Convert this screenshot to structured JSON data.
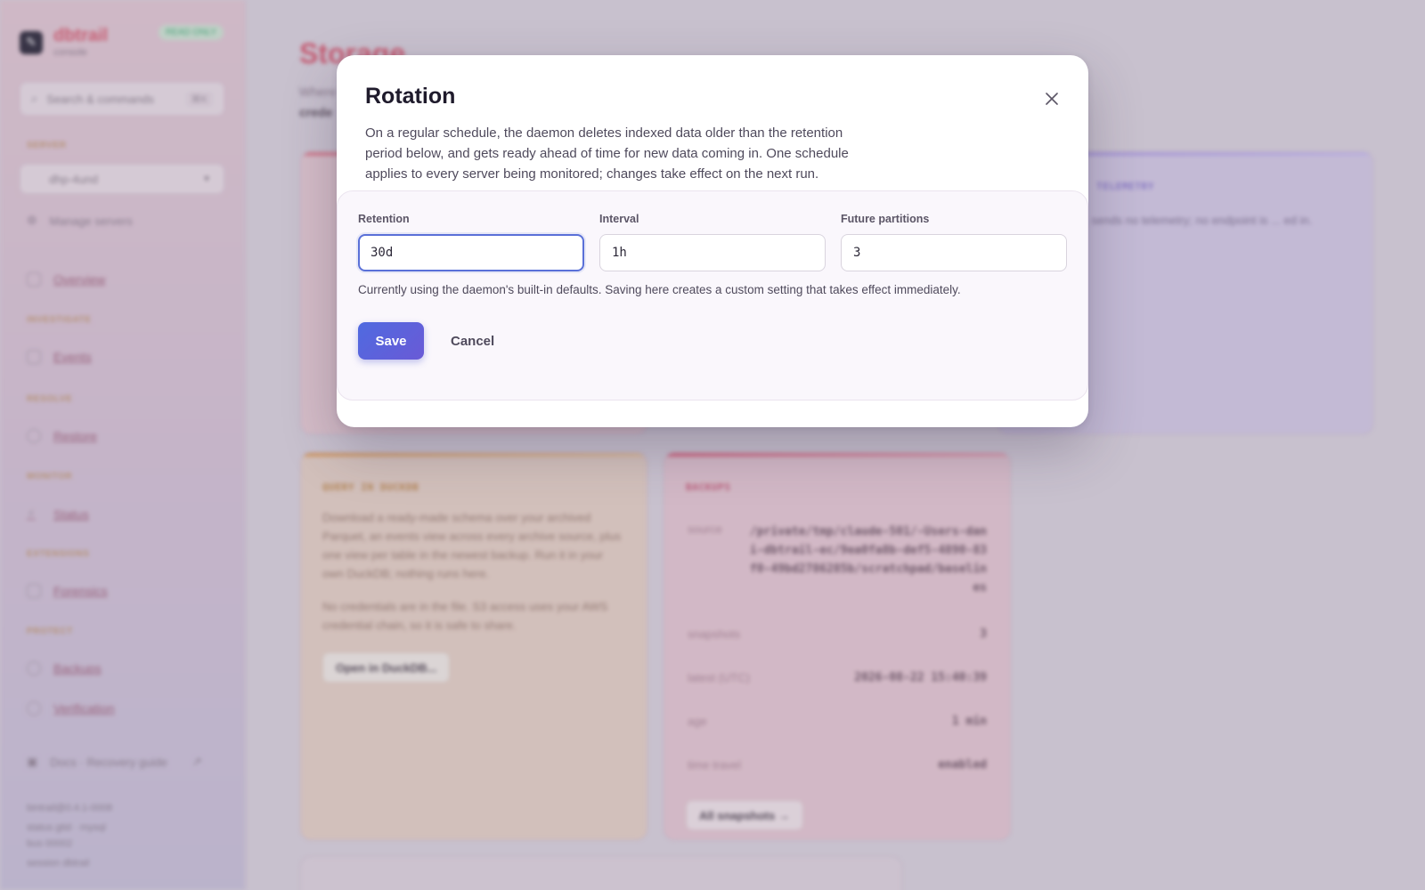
{
  "sidebar": {
    "brand_name": "dbtrail",
    "brand_sub": "console",
    "badge": "READ ONLY",
    "search_placeholder": "Search & commands",
    "search_kbd": "⌘K",
    "servers_section": "SERVER",
    "server_selected": "dhp-4und",
    "manage_servers": "Manage servers",
    "sections": [
      {
        "title": "",
        "items": [
          {
            "label": "Overview"
          }
        ]
      },
      {
        "title": "INVESTIGATE",
        "items": [
          {
            "label": "Events"
          }
        ]
      },
      {
        "title": "RESOLVE",
        "items": [
          {
            "label": "Restore"
          }
        ]
      },
      {
        "title": "MONITOR",
        "items": [
          {
            "label": "Status"
          }
        ]
      },
      {
        "title": "EXTENSIONS",
        "items": [
          {
            "label": "Forensics"
          }
        ]
      },
      {
        "title": "PROTECT",
        "items": [
          {
            "label": "Backups"
          },
          {
            "label": "Verification"
          }
        ]
      }
    ],
    "docs_link": "Docs · Recovery guide",
    "version": "bintrail@0.4.1-0008",
    "footer_1": "status gtid · mysql",
    "footer_2": "bus 00002",
    "footer_3": "session dbtrail"
  },
  "main": {
    "title": "Storage",
    "desc": "Where",
    "desc2": "crede",
    "telemetry_title": "TELEMETRY",
    "telemetry_body": "... sends no telemetry; no endpoint is ... ed in.",
    "query_title": "QUERY IN DUCKDB",
    "query_body_1": "Download a ready-made schema over your archived Parquet, an events view across every archive source, plus one view per table in the newest backup. Run it in your own DuckDB; nothing runs here.",
    "query_body_2": "No credentials are in the file. S3 access uses your AWS credential chain, so it is safe to share.",
    "query_button": "Open in DuckDB...",
    "backups_title": "BACKUPS",
    "backups": {
      "source_label": "source",
      "source_value": "/private/tmp/claude-501/-Users-dani-dbtrail-ec/9ea0fa8b-def5-4890-83f0-49bd2786285b/scratchpad/baselines",
      "snapshots_label": "snapshots",
      "snapshots_value": "3",
      "latest_label": "latest (UTC)",
      "latest_value": "2026-08-22 15:40:39",
      "age_label": "age",
      "age_value": "1 min",
      "time_travel_label": "time travel",
      "time_travel_value": "enabled",
      "button": "All snapshots →"
    }
  },
  "modal": {
    "title": "Rotation",
    "description": "On a regular schedule, the daemon deletes indexed data older than the retention period below, and gets ready ahead of time for new data coming in. One schedule applies to every server being monitored; changes take effect on the next run.",
    "fields": {
      "retention": {
        "label": "Retention",
        "value": "30d"
      },
      "interval": {
        "label": "Interval",
        "value": "1h"
      },
      "future_partitions": {
        "label": "Future partitions",
        "value": "3"
      }
    },
    "hint": "Currently using the daemon's built-in defaults. Saving here creates a custom setting that takes effect immediately.",
    "save_label": "Save",
    "cancel_label": "Cancel"
  },
  "colors": {
    "primary": "#5a6ae0",
    "title": "#1f1b2c",
    "body_text": "#4f4a5c"
  }
}
